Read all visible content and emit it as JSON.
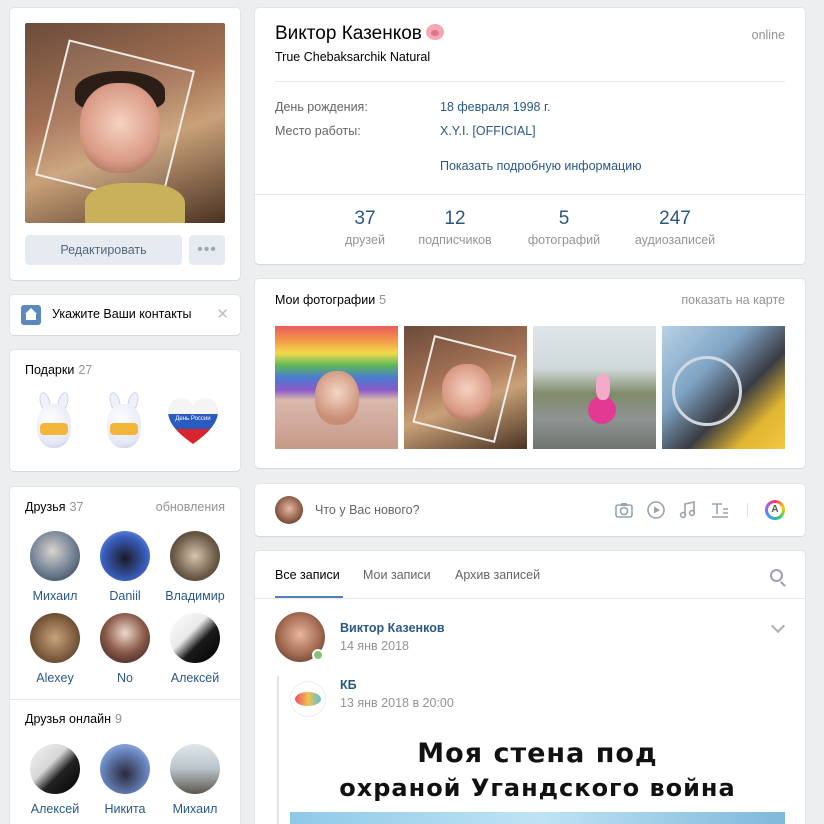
{
  "profile": {
    "name": "Виктор Казенков",
    "status": "True Chebaksarchik Natural",
    "online": "online",
    "birthday_label": "День рождения:",
    "birthday_value": "18 февраля 1998 г.",
    "work_label": "Место работы:",
    "work_value": "X.Y.I. [OFFICIAL]",
    "more_info": "Показать подробную информацию",
    "stats": [
      {
        "num": "37",
        "label": "друзей"
      },
      {
        "num": "12",
        "label": "подписчиков"
      },
      {
        "num": "5",
        "label": "фотографий"
      },
      {
        "num": "247",
        "label": "аудиозаписей"
      }
    ]
  },
  "avatar": {
    "edit_label": "Редактировать",
    "more_label": "•••"
  },
  "contacts": {
    "label": "Укажите Ваши контакты",
    "close": "✕"
  },
  "gifts": {
    "title": "Подарки",
    "count": "27",
    "heart_text": "День России"
  },
  "friends": {
    "title": "Друзья",
    "count": "37",
    "updates": "обновления",
    "items": [
      {
        "name": "Михаил"
      },
      {
        "name": "Daniil"
      },
      {
        "name": "Владимир"
      },
      {
        "name": "Alexey"
      },
      {
        "name": "No"
      },
      {
        "name": "Алексей"
      }
    ],
    "online_title": "Друзья онлайн",
    "online_count": "9",
    "online_items": [
      {
        "name": "Алексей"
      },
      {
        "name": "Никита"
      },
      {
        "name": "Михаил"
      }
    ]
  },
  "photos": {
    "title": "Мои фотографии",
    "count": "5",
    "map_link": "показать на карте"
  },
  "post_box": {
    "placeholder": "Что у Вас нового?"
  },
  "wall": {
    "tabs": [
      "Все записи",
      "Мои записи",
      "Архив записей"
    ],
    "post": {
      "author": "Виктор Казенков",
      "date": "14 янв 2018",
      "repost_author": "КБ",
      "repost_date": "13 янв 2018 в 20:00",
      "meme_line1": "Моя стена под",
      "meme_line2": "охраной Угандского война"
    }
  }
}
